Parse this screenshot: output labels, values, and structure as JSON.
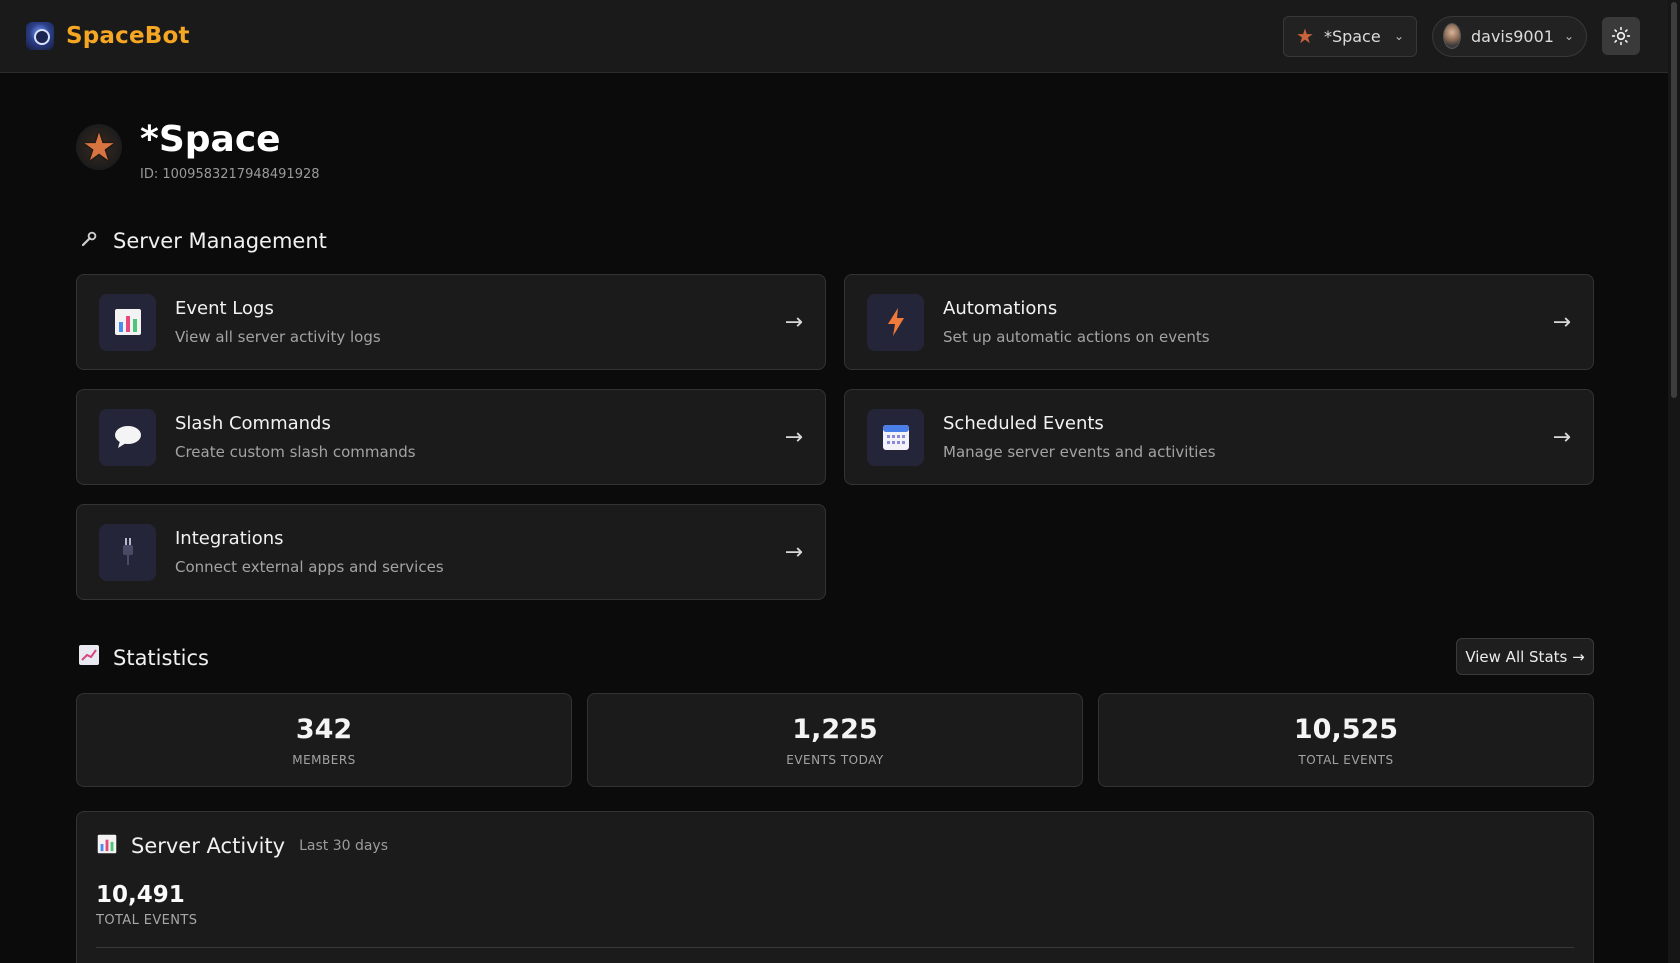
{
  "header": {
    "brand_name": "SpaceBot",
    "server_selector": {
      "label": "*Space"
    },
    "user_menu": {
      "username": "davis9001"
    }
  },
  "server": {
    "name": "*Space",
    "id_text": "ID: 1009583217948491928"
  },
  "management": {
    "title": "Server Management",
    "title_icon": "wrench-icon",
    "cards": [
      {
        "title": "Event Logs",
        "desc": "View all server activity logs",
        "icon": "bar-chart-icon"
      },
      {
        "title": "Automations",
        "desc": "Set up automatic actions on events",
        "icon": "lightning-icon"
      },
      {
        "title": "Slash Commands",
        "desc": "Create custom slash commands",
        "icon": "speech-bubble-icon"
      },
      {
        "title": "Scheduled Events",
        "desc": "Manage server events and activities",
        "icon": "calendar-icon"
      },
      {
        "title": "Integrations",
        "desc": "Connect external apps and services",
        "icon": "plug-icon"
      }
    ],
    "arrow": "→"
  },
  "statistics": {
    "title": "Statistics",
    "view_all_label": "View All Stats →",
    "stats": [
      {
        "value": "342",
        "label": "MEMBERS"
      },
      {
        "value": "1,225",
        "label": "EVENTS TODAY"
      },
      {
        "value": "10,525",
        "label": "TOTAL EVENTS"
      }
    ]
  },
  "activity": {
    "title": "Server Activity",
    "subtitle": "Last 30 days",
    "total_value": "10,491",
    "total_label": "TOTAL EVENTS"
  },
  "colors": {
    "brand": "#f5a623",
    "background": "#0b0b0b",
    "card": "#1b1b1b",
    "icon_tile": "#25253a",
    "automation_bolt": "#f07a3a"
  }
}
